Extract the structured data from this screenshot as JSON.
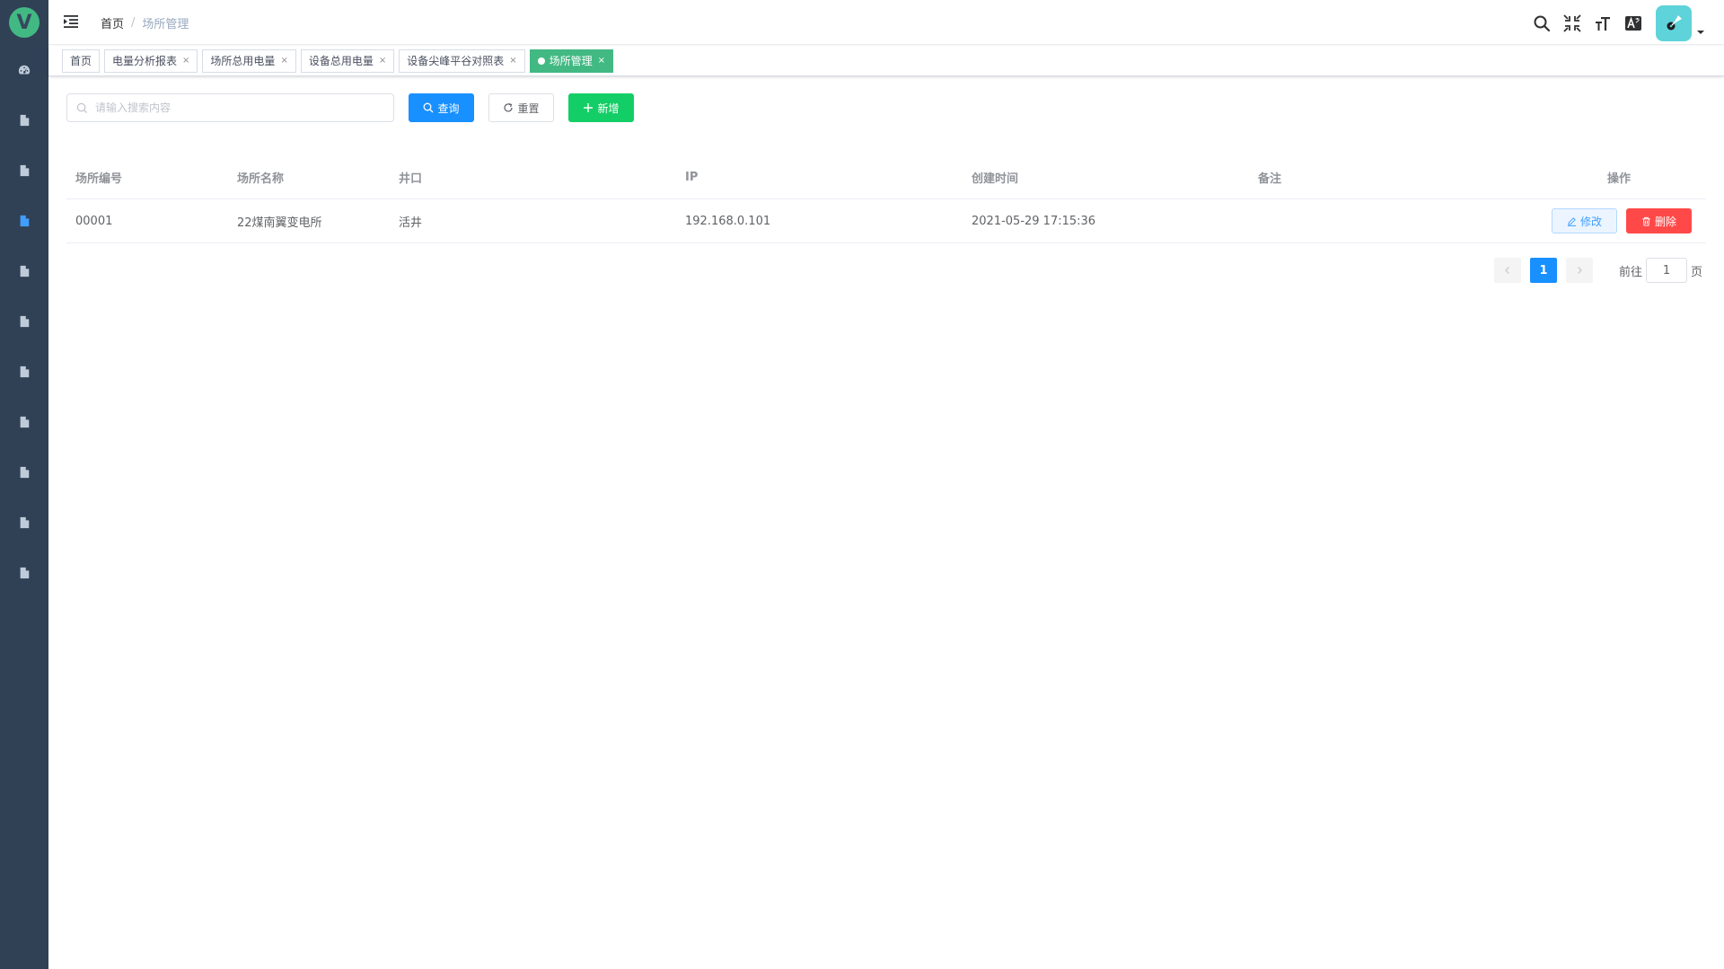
{
  "app": {
    "logo_letter": "V",
    "accent": "#42b983",
    "primary": "#1890ff",
    "sidebar_bg": "#304156"
  },
  "sidebar": {
    "items": [
      {
        "icon": "dashboard-icon",
        "active": false
      },
      {
        "icon": "document-icon",
        "active": false
      },
      {
        "icon": "document-icon",
        "active": false
      },
      {
        "icon": "document-icon",
        "active": true
      },
      {
        "icon": "document-icon",
        "active": false
      },
      {
        "icon": "document-icon",
        "active": false
      },
      {
        "icon": "document-icon",
        "active": false
      },
      {
        "icon": "document-icon",
        "active": false
      },
      {
        "icon": "document-icon",
        "active": false
      },
      {
        "icon": "document-icon",
        "active": false
      },
      {
        "icon": "document-icon",
        "active": false
      }
    ]
  },
  "breadcrumb": {
    "home": "首页",
    "separator": "/",
    "current": "场所管理"
  },
  "tags": [
    {
      "label": "首页",
      "closable": false,
      "active": false
    },
    {
      "label": "电量分析报表",
      "closable": true,
      "active": false
    },
    {
      "label": "场所总用电量",
      "closable": true,
      "active": false
    },
    {
      "label": "设备总用电量",
      "closable": true,
      "active": false
    },
    {
      "label": "设备尖峰平谷对照表",
      "closable": true,
      "active": false
    },
    {
      "label": "场所管理",
      "closable": true,
      "active": true
    }
  ],
  "tag_close_symbol": "×",
  "toolbar": {
    "search_placeholder": "请输入搜索内容",
    "search_value": "",
    "query_label": "查询",
    "reset_label": "重置",
    "add_label": "新增"
  },
  "table": {
    "headers": [
      "场所编号",
      "场所名称",
      "井口",
      "IP",
      "创建时间",
      "备注",
      "操作"
    ],
    "rows": [
      {
        "code": "00001",
        "name": "22煤南翼变电所",
        "well": "活井",
        "ip": "192.168.0.101",
        "created": "2021-05-29 17:15:36",
        "remark": ""
      }
    ],
    "edit_label": "修改",
    "delete_label": "删除"
  },
  "pagination": {
    "current_page": "1",
    "goto_prefix": "前往",
    "goto_value": "1",
    "goto_suffix": "页"
  }
}
